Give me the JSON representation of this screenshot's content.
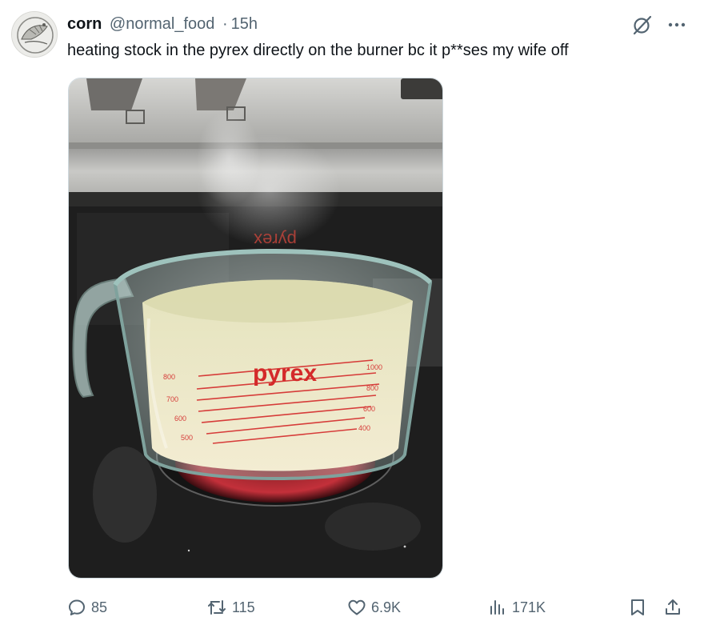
{
  "author": {
    "name": "corn",
    "handle": "@normal_food",
    "separator": "·",
    "time": "15h"
  },
  "tweet": {
    "text": "heating stock in the pyrex directly on the burner bc it p**ses my wife off"
  },
  "media": {
    "brand_text": "pyrex",
    "mirrored_brand_text": "pyrex"
  },
  "actions": {
    "replies": "85",
    "retweets": "115",
    "likes": "6.9K",
    "views": "171K"
  },
  "icons": {
    "reply": "reply-icon",
    "retweet": "retweet-icon",
    "like": "heart-icon",
    "views": "views-icon",
    "bookmark": "bookmark-icon",
    "share": "share-icon",
    "grok": "grok-icon",
    "more": "more-icon"
  },
  "colors": {
    "text": "#0f1419",
    "secondary": "#536471",
    "border": "#cfd9de",
    "pyrex_red": "#d42a2a"
  }
}
